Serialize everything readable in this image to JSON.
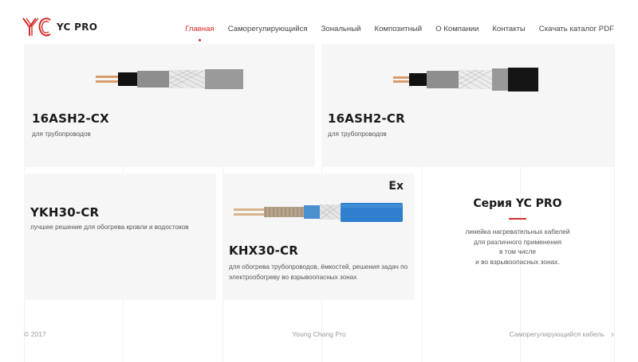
{
  "brand": {
    "name": "YC PRO",
    "accent": "#d52b2b"
  },
  "nav": [
    {
      "label": "Главная",
      "active": true
    },
    {
      "label": "Саморегулирующийся"
    },
    {
      "label": "Зональный"
    },
    {
      "label": "Композитный"
    },
    {
      "label": "О Компании"
    },
    {
      "label": "Контакты"
    },
    {
      "label": "Скачать каталог PDF"
    }
  ],
  "products": [
    {
      "title": "16ASH2-CX",
      "subtitle": "для трубопроводов"
    },
    {
      "title": "16ASH2-CR",
      "subtitle": "для трубопроводов"
    },
    {
      "title": "YKH30-CR",
      "subtitle": "лучшее решение для обогрева кровли и водостоков"
    },
    {
      "title": "KHX30-CR",
      "subtitle": "для обогрева трубопроводов, ёмкостей, решения задач по электрообогреву во взрывоопасных зонах",
      "badge": "Ex"
    }
  ],
  "series": {
    "title": "Серия YC PRO",
    "desc": [
      "линейка нагревательных кабелей",
      "для различного применения",
      "в том числе",
      "и во взрывоопасных зонах."
    ]
  },
  "footer": {
    "copyright": "© 2017",
    "brand": "Young Chang Pro",
    "next_label": "Саморегулирующийся кабель"
  }
}
